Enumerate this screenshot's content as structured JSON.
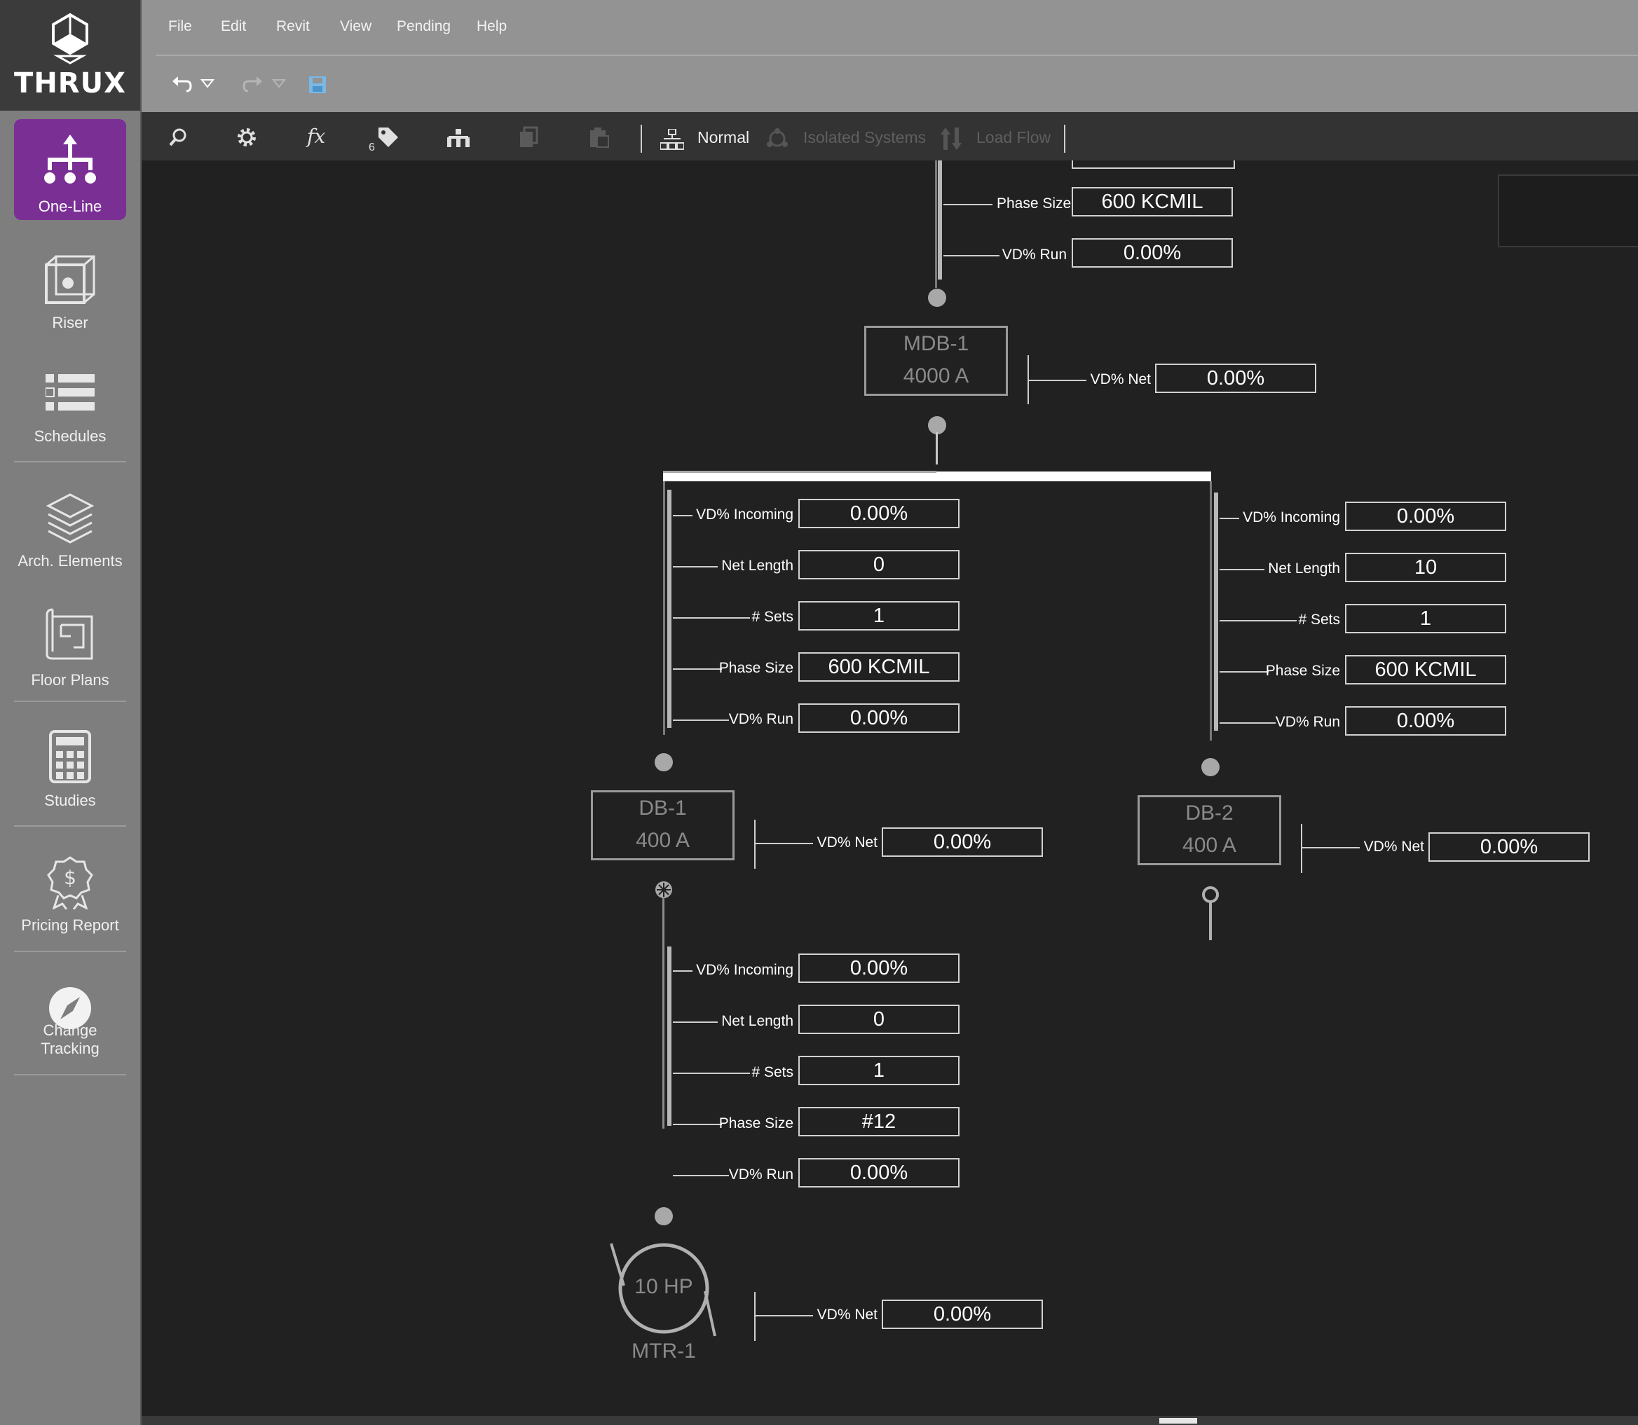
{
  "app": {
    "logo": "THRUX"
  },
  "sidebar": {
    "items": [
      {
        "label": "One-Line",
        "icon": "one-line-icon",
        "active": true
      },
      {
        "label": "Riser",
        "icon": "riser-cube-icon"
      },
      {
        "label": "Schedules",
        "icon": "schedules-list-icon"
      },
      {
        "label": "Arch. Elements",
        "icon": "layers-icon"
      },
      {
        "label": "Floor Plans",
        "icon": "floor-plan-icon"
      },
      {
        "label": "Studies",
        "icon": "calculator-icon"
      },
      {
        "label": "Pricing Report",
        "icon": "dollar-badge-icon"
      },
      {
        "label": "Change Tracking",
        "icon": "compass-icon"
      }
    ]
  },
  "menu": {
    "items": [
      "File",
      "Edit",
      "Revit",
      "View",
      "Pending",
      "Help"
    ]
  },
  "toolbar": {
    "tag_count": "6",
    "mode_normal": "Normal",
    "mode_isolated": "Isolated Systems",
    "mode_loadflow": "Load Flow"
  },
  "diagram": {
    "top_feeder": {
      "phase_size_label": "Phase Size",
      "phase_size": "600 KCMIL",
      "vd_run_label": "VD% Run",
      "vd_run": "0.00%"
    },
    "mdb1": {
      "name": "MDB-1",
      "rating": "4000 A",
      "vd_net_label": "VD% Net",
      "vd_net": "0.00%"
    },
    "feeder_db1": {
      "vd_incoming_label": "VD% Incoming",
      "vd_incoming": "0.00%",
      "net_length_label": "Net Length",
      "net_length": "0",
      "sets_label": "# Sets",
      "sets": "1",
      "phase_size_label": "Phase Size",
      "phase_size": "600 KCMIL",
      "vd_run_label": "VD% Run",
      "vd_run": "0.00%"
    },
    "feeder_db2": {
      "vd_incoming_label": "VD% Incoming",
      "vd_incoming": "0.00%",
      "net_length_label": "Net Length",
      "net_length": "10",
      "sets_label": "# Sets",
      "sets": "1",
      "phase_size_label": "Phase Size",
      "phase_size": "600 KCMIL",
      "vd_run_label": "VD% Run",
      "vd_run": "0.00%"
    },
    "db1": {
      "name": "DB-1",
      "rating": "400 A",
      "vd_net_label": "VD% Net",
      "vd_net": "0.00%"
    },
    "db2": {
      "name": "DB-2",
      "rating": "400 A",
      "vd_net_label": "VD% Net",
      "vd_net": "0.00%"
    },
    "feeder_mtr1": {
      "vd_incoming_label": "VD% Incoming",
      "vd_incoming": "0.00%",
      "net_length_label": "Net Length",
      "net_length": "0",
      "sets_label": "# Sets",
      "sets": "1",
      "phase_size_label": "Phase Size",
      "phase_size": "#12",
      "vd_run_label": "VD% Run",
      "vd_run": "0.00%"
    },
    "mtr1": {
      "name": "MTR-1",
      "hp": "10 HP",
      "vd_net_label": "VD% Net",
      "vd_net": "0.00%"
    }
  }
}
